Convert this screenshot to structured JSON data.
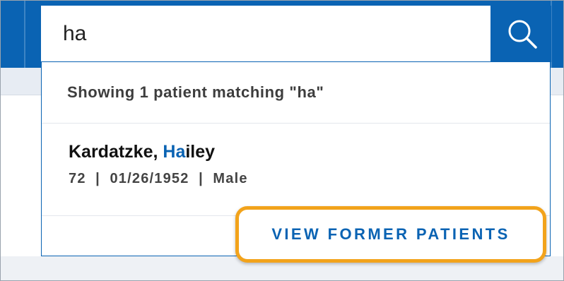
{
  "search": {
    "query": "ha",
    "button_icon": "search-icon"
  },
  "results": {
    "summary": "Showing 1 patient matching \"ha\"",
    "patients": [
      {
        "name_prefix": "Kardatzke, ",
        "name_highlight": "Ha",
        "name_suffix": "iley",
        "meta": "72  |  01/26/1952  |  Male"
      }
    ]
  },
  "actions": {
    "view_former_label": "VIEW FORMER PATIENTS"
  },
  "colors": {
    "brand_blue": "#0a63b3",
    "highlight_outline": "#f2a31b"
  }
}
